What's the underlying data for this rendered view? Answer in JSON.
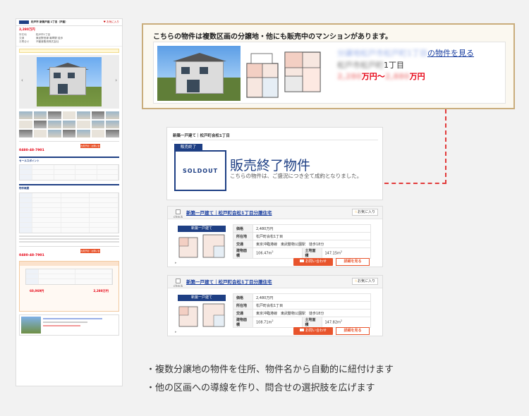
{
  "left_page": {
    "header_title": "松戸市 新築戸建 1丁目（戸建）",
    "favorite": "♥ お気に入り",
    "price": "2,280万円",
    "summary_rows": [
      {
        "k": "所在地",
        "v": "松戸市1丁目"
      },
      {
        "k": "交通",
        "v": "東武野田線 最寄駅 徒歩"
      },
      {
        "k": "お問合せ",
        "v": "不動産販売株式会社"
      }
    ],
    "contact_tel": "0480-48-7901",
    "contact_button": "内見予約・お問い合わせ",
    "section_points": "セールスポイント",
    "section_overview": "物件概要",
    "contact_tel_2": "0480-48-7901",
    "contact_button_2": "内見予約・お問い合わせ",
    "form_total_left": "60,069円",
    "form_total_right": "2,280万円"
  },
  "banner": {
    "title": "こちらの物件は複数区画の分譲地・他にも販売中のマンションがあります。",
    "link_blur": "分譲地松戸市松戸町1丁目",
    "link_text": "の物件を見る",
    "addr_blur": "松戸市松戸町",
    "addr_text": "1丁目",
    "price_from_blur": "2,280",
    "price_from": "万円〜",
    "price_to_blur": "2,880",
    "price_to": "万円"
  },
  "sold": {
    "breadcrumb": "新築一戸建て｜松戸町会松1丁目",
    "tag": "販売終了",
    "stamp": "SOLDOUT",
    "title": "販売終了物件",
    "description": "こちらの物件は、ご盛況につき全て成約となりました。"
  },
  "cards": [
    {
      "name": "新築一戸建て｜松戸町会松1丁目分譲住宅",
      "check": "check",
      "favorite": "お気に入り",
      "type": "新築一戸建て",
      "rows": [
        {
          "k": "価格",
          "v": "2,480万円"
        },
        {
          "k": "所在地",
          "v": "松戸町会松1丁目"
        },
        {
          "k": "交通",
          "v": "東京沖臨港線　東武動物公園駅　徒歩18分"
        }
      ],
      "area_label": "建物面積",
      "area_value": "106.47m",
      "land_label": "土地面積",
      "land_value": "147.15m",
      "btn_mail": "お問い合わせ",
      "btn_detail": "詳細を見る"
    },
    {
      "name": "新築一戸建て｜松戸町会松1丁目分譲住宅",
      "check": "check",
      "favorite": "お気に入り",
      "type": "新築一戸建て",
      "rows": [
        {
          "k": "価格",
          "v": "2,480万円"
        },
        {
          "k": "所在地",
          "v": "松戸町会松1丁目"
        },
        {
          "k": "交通",
          "v": "東京沖臨港線　東武動物公園駅　徒歩18分"
        }
      ],
      "area_label": "建物面積",
      "area_value": "108.71m",
      "land_label": "土地面積",
      "land_value": "147.82m",
      "btn_mail": "お問い合わせ",
      "btn_detail": "詳細を見る"
    }
  ],
  "bullets": [
    "・複数分譲地の物件を住所、物件名から自動的に紐付けます",
    "・他の区画への導線を作り、問合せの選択肢を広げます"
  ],
  "colors": {
    "brand_navy": "#1e3f84",
    "price_red": "#e60012",
    "cta_orange": "#e8542c",
    "banner_border": "#c9ad7c",
    "connector": "#e23a3a"
  }
}
